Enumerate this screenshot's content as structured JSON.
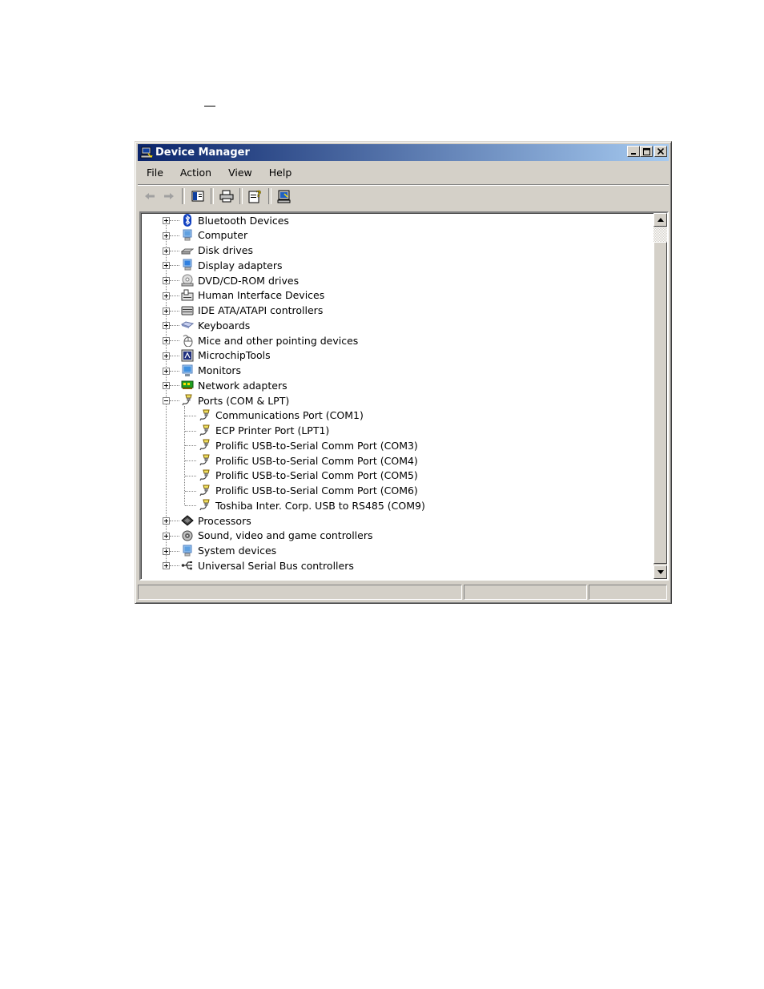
{
  "window": {
    "title": "Device Manager"
  },
  "menu": [
    "File",
    "Action",
    "View",
    "Help"
  ],
  "toolbar": [
    "back-icon",
    "forward-icon",
    "show-hide-tree-icon",
    "print-icon",
    "properties-icon",
    "update-driver-icon"
  ],
  "tree": [
    {
      "label": "Bluetooth Devices",
      "icon": "bluetooth-icon",
      "level": 0,
      "state": "collapsed"
    },
    {
      "label": "Computer",
      "icon": "computer-icon",
      "level": 0,
      "state": "collapsed"
    },
    {
      "label": "Disk drives",
      "icon": "disk-drive-icon",
      "level": 0,
      "state": "collapsed"
    },
    {
      "label": "Display adapters",
      "icon": "display-adapter-icon",
      "level": 0,
      "state": "collapsed"
    },
    {
      "label": "DVD/CD-ROM drives",
      "icon": "dvd-drive-icon",
      "level": 0,
      "state": "collapsed"
    },
    {
      "label": "Human Interface Devices",
      "icon": "hid-icon",
      "level": 0,
      "state": "collapsed"
    },
    {
      "label": "IDE ATA/ATAPI controllers",
      "icon": "ide-controller-icon",
      "level": 0,
      "state": "collapsed"
    },
    {
      "label": "Keyboards",
      "icon": "keyboard-icon",
      "level": 0,
      "state": "collapsed"
    },
    {
      "label": "Mice and other pointing devices",
      "icon": "mouse-icon",
      "level": 0,
      "state": "collapsed"
    },
    {
      "label": "MicrochipTools",
      "icon": "microchip-tools-icon",
      "level": 0,
      "state": "collapsed"
    },
    {
      "label": "Monitors",
      "icon": "monitor-icon",
      "level": 0,
      "state": "collapsed"
    },
    {
      "label": "Network adapters",
      "icon": "network-adapter-icon",
      "level": 0,
      "state": "collapsed"
    },
    {
      "label": "Ports (COM & LPT)",
      "icon": "port-icon",
      "level": 0,
      "state": "expanded"
    },
    {
      "label": "Communications Port (COM1)",
      "icon": "port-icon",
      "level": 1
    },
    {
      "label": "ECP Printer Port (LPT1)",
      "icon": "port-icon",
      "level": 1
    },
    {
      "label": "Prolific USB-to-Serial Comm Port (COM3)",
      "icon": "port-icon",
      "level": 1
    },
    {
      "label": "Prolific USB-to-Serial Comm Port (COM4)",
      "icon": "port-icon",
      "level": 1
    },
    {
      "label": "Prolific USB-to-Serial Comm Port (COM5)",
      "icon": "port-icon",
      "level": 1
    },
    {
      "label": "Prolific USB-to-Serial Comm Port (COM6)",
      "icon": "port-icon",
      "level": 1
    },
    {
      "label": "Toshiba Inter. Corp. USB to RS485 (COM9)",
      "icon": "port-icon",
      "level": 1
    },
    {
      "label": "Processors",
      "icon": "processor-icon",
      "level": 0,
      "state": "collapsed"
    },
    {
      "label": "Sound, video and game controllers",
      "icon": "sound-icon",
      "level": 0,
      "state": "collapsed"
    },
    {
      "label": "System devices",
      "icon": "system-device-icon",
      "level": 0,
      "state": "collapsed"
    },
    {
      "label": "Universal Serial Bus controllers",
      "icon": "usb-icon",
      "level": 0,
      "state": "collapsed"
    }
  ],
  "scrollbar": {
    "position": 0
  }
}
